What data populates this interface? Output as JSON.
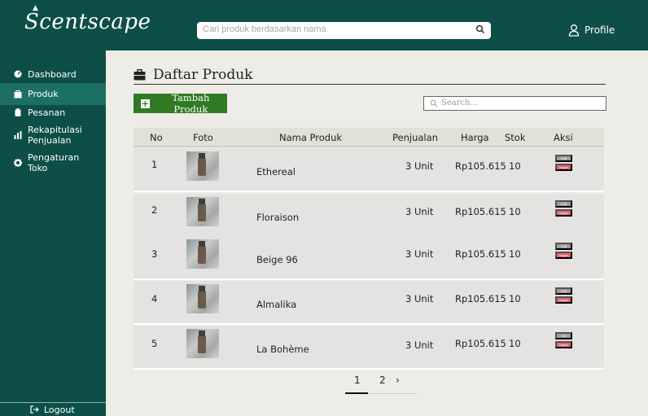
{
  "app": {
    "logo": "Scentscape",
    "search_placeholder": "Cari produk berdasarkan nama",
    "profile_label": "Profile"
  },
  "sidebar": {
    "items": [
      {
        "label": "Dashboard",
        "icon": "dashboard-icon",
        "active": false
      },
      {
        "label": "Produk",
        "icon": "box-icon",
        "active": true
      },
      {
        "label": "Pesanan",
        "icon": "clipboard-icon",
        "active": false
      },
      {
        "label": "Rekapitulasi Penjualan",
        "icon": "bar-chart-icon",
        "active": false
      },
      {
        "label": "Pengaturan Toko",
        "icon": "gear-icon",
        "active": false
      }
    ],
    "logout_label": "Logout"
  },
  "main": {
    "page_title": "Daftar Produk",
    "add_button_label": "Tambah Produk",
    "search_placeholder": "Search...",
    "table": {
      "columns": [
        "No",
        "Foto",
        "Nama Produk",
        "Penjualan",
        "Harga",
        "Stok",
        "Aksi"
      ],
      "rows": [
        {
          "no": "1",
          "name": "Ethereal",
          "sales": "3 Unit",
          "price": "Rp105.615",
          "stock": "10"
        },
        {
          "no": "2",
          "name": "Floraison",
          "sales": "3 Unit",
          "price": "Rp105.615",
          "stock": "10"
        },
        {
          "no": "3",
          "name": "Beige 96",
          "sales": "3 Unit",
          "price": "Rp105.615",
          "stock": "10"
        },
        {
          "no": "4",
          "name": "Almalika",
          "sales": "3 Unit",
          "price": "Rp105.615",
          "stock": "10"
        },
        {
          "no": "5",
          "name": "La Bohème",
          "sales": "3 Unit",
          "price": "Rp105.615",
          "stock": "10"
        }
      ],
      "edit_label": "Edit",
      "delete_label": "Hapus"
    },
    "pagination": {
      "pages": [
        "1",
        "2"
      ],
      "current": "1",
      "next": "›"
    }
  },
  "colors": {
    "brand": "#0d4f47",
    "active_nav": "#1c6f63",
    "add_button": "#2f7a22",
    "delete": "#e3616a",
    "edit": "#9c9c9c",
    "background": "#eeece6"
  }
}
